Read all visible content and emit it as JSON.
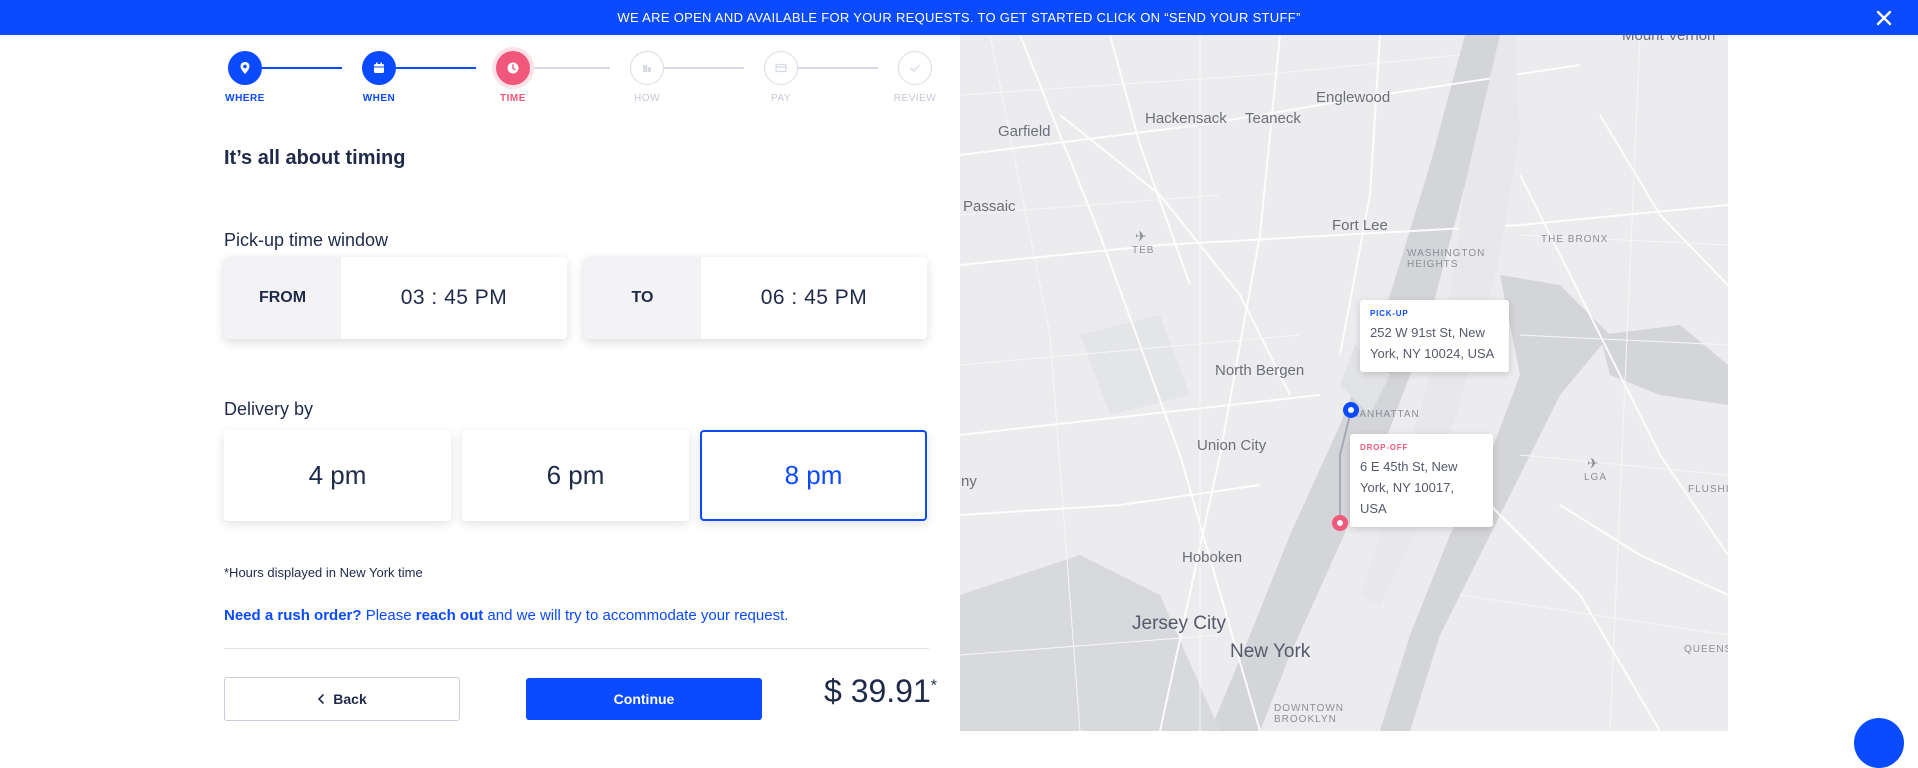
{
  "banner": {
    "text": "WE ARE OPEN AND AVAILABLE FOR YOUR REQUESTS. TO GET STARTED CLICK ON “SEND YOUR STUFF”",
    "close_icon": "close-icon"
  },
  "steps": [
    {
      "label": "WHERE",
      "icon": "location-pin-icon",
      "state": "done"
    },
    {
      "label": "WHEN",
      "icon": "calendar-icon",
      "state": "done"
    },
    {
      "label": "TIME",
      "icon": "clock-icon",
      "state": "active"
    },
    {
      "label": "HOW",
      "icon": "box-icon",
      "state": "todo"
    },
    {
      "label": "PAY",
      "icon": "credit-card-icon",
      "state": "todo"
    },
    {
      "label": "REVIEW",
      "icon": "check-icon",
      "state": "todo"
    }
  ],
  "title": "It’s all about timing",
  "pickup": {
    "label": "Pick-up time window",
    "from_tag": "FROM",
    "from_value": "03 : 45  PM",
    "to_tag": "TO",
    "to_value": "06 : 45  PM"
  },
  "delivery": {
    "label": "Delivery by",
    "options": [
      "4 pm",
      "6 pm",
      "8 pm"
    ],
    "selected": "8 pm"
  },
  "note": "*Hours displayed in New York time",
  "rush": {
    "lead": "Need a rush order?",
    "please": " Please ",
    "link": "reach out",
    "tail": " and we will try to accommodate your request."
  },
  "buttons": {
    "back": "Back",
    "continue": "Continue"
  },
  "price": {
    "amount": "$ 39.91",
    "asterisk": "*"
  },
  "map": {
    "labels": {
      "mount_vernon": "Mount Vernon",
      "englewood": "Englewood",
      "garfield": "Garfield",
      "hackensack": "Hackensack",
      "teaneck": "Teaneck",
      "passaic": "Passaic",
      "fort_lee": "Fort Lee",
      "the_bronx": "THE BRONX",
      "teb": "TEB",
      "washington_heights": "WASHINGTON\nHEIGHTS",
      "north_bergen": "North Bergen",
      "manhattan": "MANHATTAN",
      "union_city": "Union City",
      "lga": "LGA",
      "flushing": "FLUSHI",
      "hoboken": "Hoboken",
      "jersey_city": "Jersey City",
      "new_york": "New York",
      "queens": "QUEENS",
      "downtown_brooklyn": "DOWNTOWN\nBROOKLYN",
      "ny_fragment": "ny"
    },
    "pickup_popup": {
      "tag": "PICK-UP",
      "address": "252 W 91st St, New York, NY 10024, USA",
      "color": "#0a4bff"
    },
    "dropoff_popup": {
      "tag": "DROP-OFF",
      "address": "6 E 45th St, New York, NY 10017, USA",
      "color": "#f0577a"
    }
  },
  "colors": {
    "primary": "#0a4bff",
    "active": "#f0577a",
    "text": "#1f2a4a"
  }
}
